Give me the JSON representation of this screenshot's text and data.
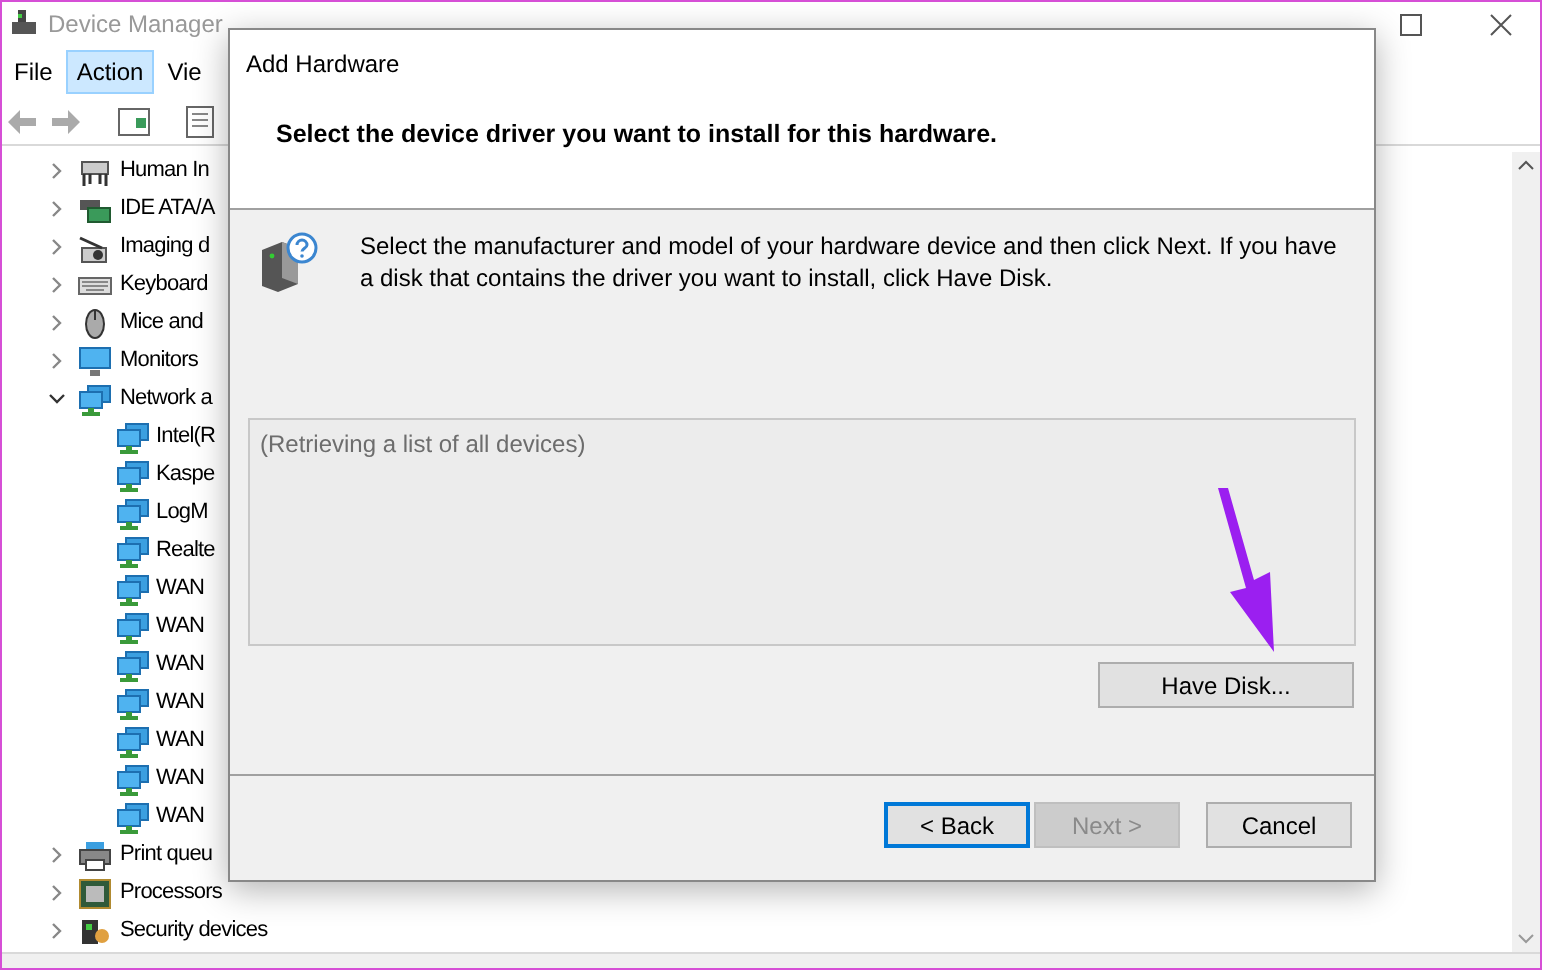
{
  "main_window": {
    "title": "Device Manager",
    "menu": [
      {
        "label": "File",
        "selected": false
      },
      {
        "label": "Action",
        "selected": true
      },
      {
        "label": "Vie",
        "selected": false
      }
    ],
    "tree": [
      {
        "label": "Human In",
        "kind": "hid",
        "expanded": false
      },
      {
        "label": "IDE ATA/A",
        "kind": "ide",
        "expanded": false
      },
      {
        "label": "Imaging d",
        "kind": "camera",
        "expanded": false
      },
      {
        "label": "Keyboard",
        "kind": "keyboard",
        "expanded": false
      },
      {
        "label": "Mice and",
        "kind": "mouse",
        "expanded": false
      },
      {
        "label": "Monitors",
        "kind": "monitor",
        "expanded": false
      },
      {
        "label": "Network a",
        "kind": "network",
        "expanded": true,
        "children": [
          {
            "label": "Intel(R",
            "kind": "network"
          },
          {
            "label": "Kaspe",
            "kind": "network"
          },
          {
            "label": "LogM",
            "kind": "network"
          },
          {
            "label": "Realte",
            "kind": "network"
          },
          {
            "label": "WAN",
            "kind": "network"
          },
          {
            "label": "WAN",
            "kind": "network"
          },
          {
            "label": "WAN",
            "kind": "network"
          },
          {
            "label": "WAN",
            "kind": "network"
          },
          {
            "label": "WAN",
            "kind": "network"
          },
          {
            "label": "WAN",
            "kind": "network"
          },
          {
            "label": "WAN",
            "kind": "network"
          }
        ]
      },
      {
        "label": "Print queu",
        "kind": "printer",
        "expanded": false
      },
      {
        "label": "Processors",
        "kind": "cpu",
        "expanded": false
      },
      {
        "label": "Security devices",
        "kind": "security",
        "expanded": false
      }
    ]
  },
  "dialog": {
    "title": "Add Hardware",
    "heading": "Select the device driver you want to install for this hardware.",
    "instructions": "Select the manufacturer and model of your hardware device and then click Next. If you have a disk that contains the driver you want to install, click Have Disk.",
    "list_placeholder": "(Retrieving a list of all devices)",
    "have_disk": {
      "label": "Have Disk...",
      "disabled": false
    },
    "buttons": [
      {
        "label": "< Back",
        "focused": true,
        "disabled": false
      },
      {
        "label": "Next >",
        "focused": false,
        "disabled": true
      },
      {
        "label": "Cancel",
        "focused": false,
        "disabled": false
      }
    ]
  }
}
